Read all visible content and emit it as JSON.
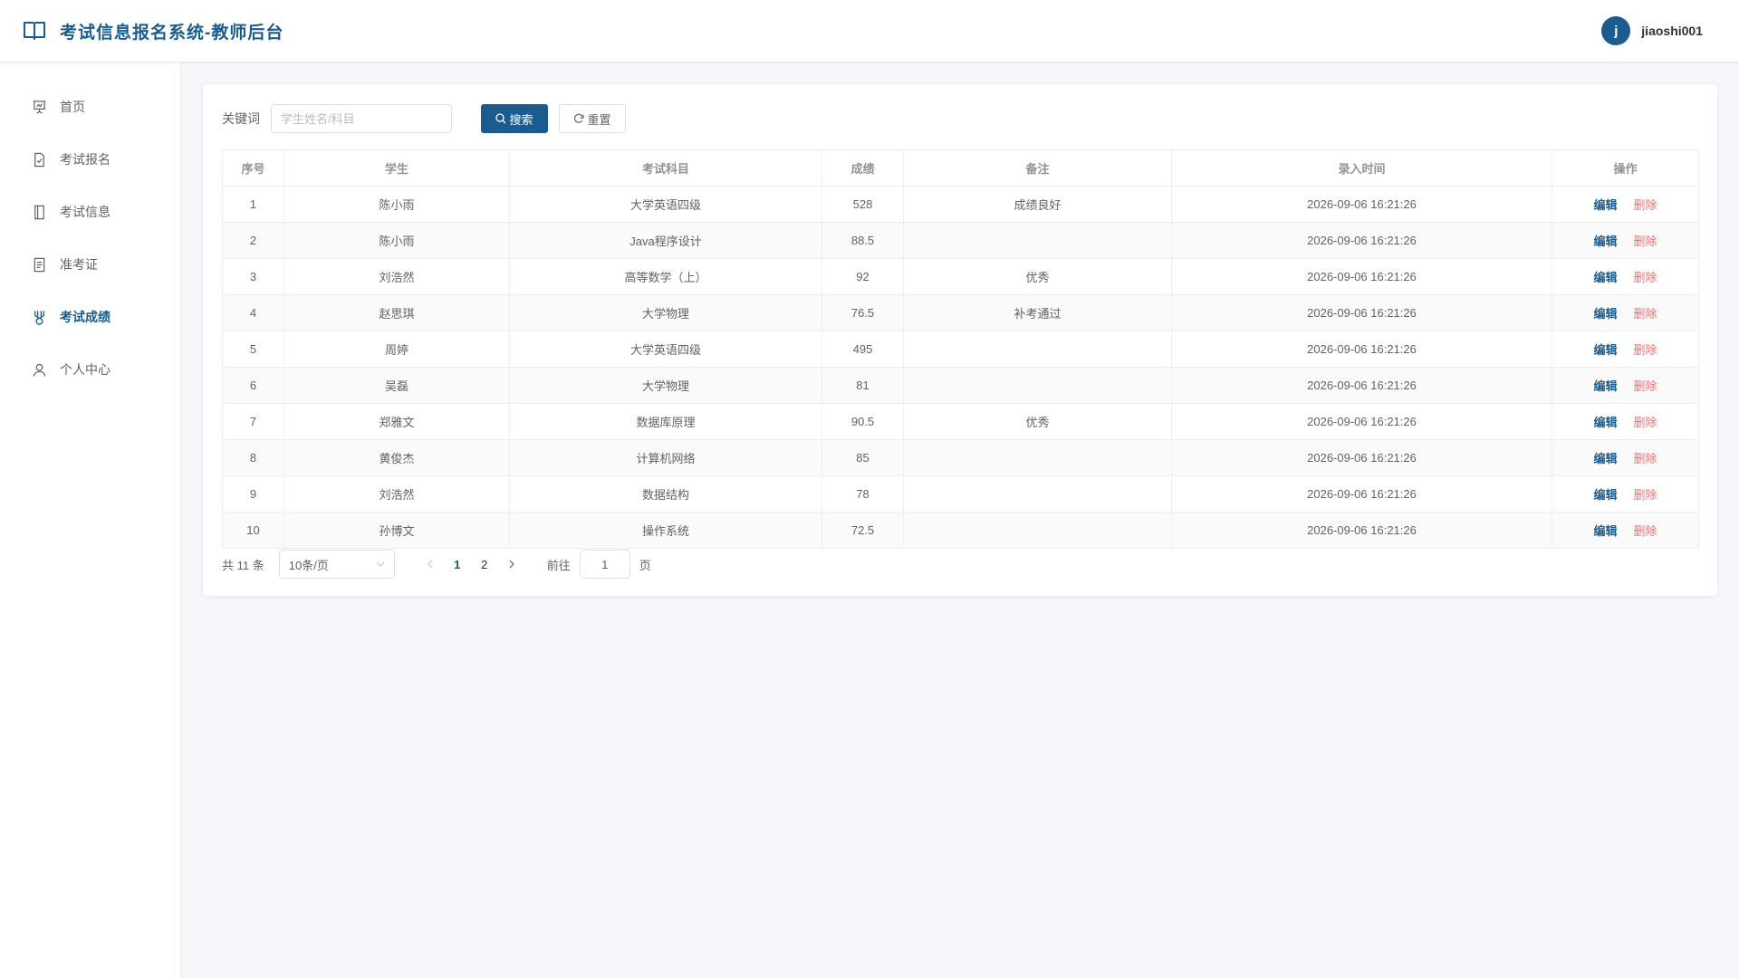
{
  "header": {
    "title": "考试信息报名系统-教师后台",
    "avatar_letter": "j",
    "username": "jiaoshi001"
  },
  "sidebar": {
    "items": [
      {
        "label": "首页",
        "icon": "presentation-icon",
        "active": false
      },
      {
        "label": "考试报名",
        "icon": "document-check-icon",
        "active": false
      },
      {
        "label": "考试信息",
        "icon": "notebook-icon",
        "active": false
      },
      {
        "label": "准考证",
        "icon": "tickets-icon",
        "active": false
      },
      {
        "label": "考试成绩",
        "icon": "medal-icon",
        "active": true
      },
      {
        "label": "个人中心",
        "icon": "user-icon",
        "active": false
      }
    ]
  },
  "search": {
    "label": "关键词",
    "placeholder": "学生姓名/科目",
    "value": "",
    "search_button": "搜索",
    "reset_button": "重置"
  },
  "table": {
    "columns": [
      "序号",
      "学生",
      "考试科目",
      "成绩",
      "备注",
      "录入时间",
      "操作"
    ],
    "edit_label": "编辑",
    "delete_label": "删除",
    "rows": [
      {
        "no": "1",
        "student": "陈小雨",
        "subject": "大学英语四级",
        "score": "528",
        "remark": "成绩良好",
        "time": "2026-09-06 16:21:26"
      },
      {
        "no": "2",
        "student": "陈小雨",
        "subject": "Java程序设计",
        "score": "88.5",
        "remark": "",
        "time": "2026-09-06 16:21:26"
      },
      {
        "no": "3",
        "student": "刘浩然",
        "subject": "高等数学（上）",
        "score": "92",
        "remark": "优秀",
        "time": "2026-09-06 16:21:26"
      },
      {
        "no": "4",
        "student": "赵思琪",
        "subject": "大学物理",
        "score": "76.5",
        "remark": "补考通过",
        "time": "2026-09-06 16:21:26"
      },
      {
        "no": "5",
        "student": "周婷",
        "subject": "大学英语四级",
        "score": "495",
        "remark": "",
        "time": "2026-09-06 16:21:26"
      },
      {
        "no": "6",
        "student": "吴磊",
        "subject": "大学物理",
        "score": "81",
        "remark": "",
        "time": "2026-09-06 16:21:26"
      },
      {
        "no": "7",
        "student": "郑雅文",
        "subject": "数据库原理",
        "score": "90.5",
        "remark": "优秀",
        "time": "2026-09-06 16:21:26"
      },
      {
        "no": "8",
        "student": "黄俊杰",
        "subject": "计算机网络",
        "score": "85",
        "remark": "",
        "time": "2026-09-06 16:21:26"
      },
      {
        "no": "9",
        "student": "刘浩然",
        "subject": "数据结构",
        "score": "78",
        "remark": "",
        "time": "2026-09-06 16:21:26"
      },
      {
        "no": "10",
        "student": "孙博文",
        "subject": "操作系统",
        "score": "72.5",
        "remark": "",
        "time": "2026-09-06 16:21:26"
      }
    ]
  },
  "pagination": {
    "total_text": "共 11 条",
    "page_size": "10条/页",
    "pages": [
      "1",
      "2"
    ],
    "current_page": "1",
    "goto_label": "前往",
    "goto_value": "1",
    "page_unit": "页"
  },
  "colors": {
    "primary": "#1a5c8f",
    "danger": "#f56c6c"
  }
}
